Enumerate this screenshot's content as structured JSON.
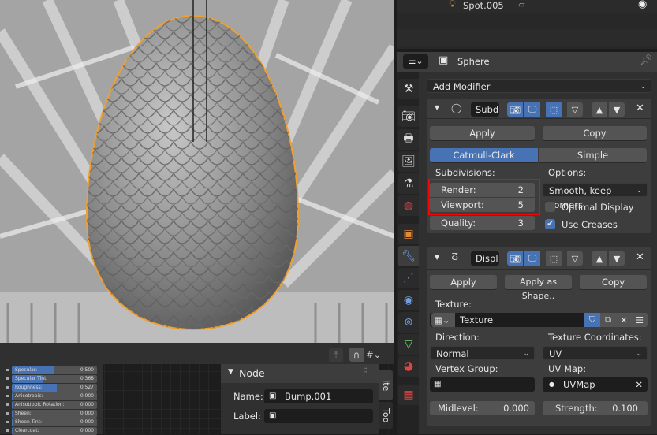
{
  "outliner": {
    "item": "Spot.005"
  },
  "properties": {
    "object_name": "Sphere",
    "add_modifier": "Add Modifier",
    "subsurf": {
      "name": "Subd",
      "apply": "Apply",
      "copy": "Copy",
      "mode_catmull": "Catmull-Clark",
      "mode_simple": "Simple",
      "subdivisions_label": "Subdivisions:",
      "render_label": "Render:",
      "render_value": "2",
      "viewport_label": "Viewport:",
      "viewport_value": "5",
      "quality_label": "Quality:",
      "quality_value": "3",
      "options_label": "Options:",
      "uv_smooth": "Smooth, keep corners",
      "optimal_display": "Optimal Display",
      "optimal_display_checked": false,
      "use_creases": "Use Creases",
      "use_creases_checked": true
    },
    "displace": {
      "name": "Displ",
      "apply": "Apply",
      "apply_shape": "Apply as Shape..",
      "copy": "Copy",
      "texture_label": "Texture:",
      "texture": "Texture",
      "direction_label": "Direction:",
      "direction": "Normal",
      "texcoords_label": "Texture Coordinates:",
      "texcoords": "UV",
      "vgroup_label": "Vertex Group:",
      "vgroup": "",
      "uvmap_label": "UV Map:",
      "uvmap": "UVMap",
      "midlevel_label": "Midlevel:",
      "midlevel": "0.000",
      "strength_label": "Strength:",
      "strength": "0.100"
    },
    "highlight_color": "#ff0000",
    "accent": "#4772b3"
  },
  "node_editor": {
    "sliders": [
      {
        "name": "Specular:",
        "value": "0.500",
        "fill": 0.5
      },
      {
        "name": "Specular Tint:",
        "value": "0.368",
        "fill": 0.368
      },
      {
        "name": "Roughness:",
        "value": "0.527",
        "fill": 0.527
      },
      {
        "name": "Anisotropic:",
        "value": "0.000",
        "fill": 0
      },
      {
        "name": "Anisotropic Rotation:",
        "value": "0.000",
        "fill": 0
      },
      {
        "name": "Sheen:",
        "value": "0.000",
        "fill": 0
      },
      {
        "name": "Sheen Tint:",
        "value": "0.000",
        "fill": 0
      },
      {
        "name": "Clearcoat:",
        "value": "0.000",
        "fill": 0
      }
    ],
    "panel_title": "Node",
    "name_label": "Name:",
    "name_value": "Bump.001",
    "label_label": "Label:",
    "label_value": "",
    "tabs": [
      "Ite",
      "Too"
    ]
  }
}
